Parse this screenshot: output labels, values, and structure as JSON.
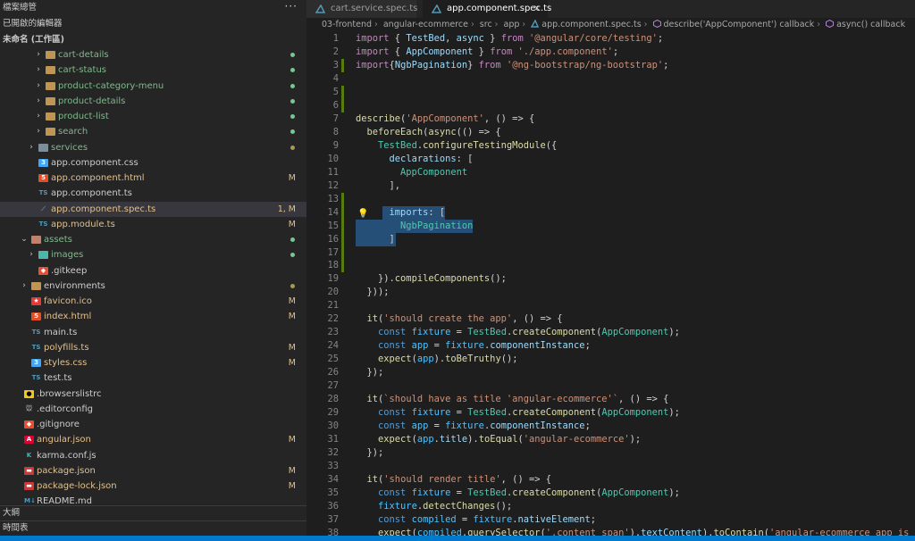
{
  "explorer": {
    "title": "檔案總管",
    "more": "···",
    "open_editors": "已開啟的編輯器",
    "workspace": "未命名 (工作區)",
    "outline": "大綱",
    "timeline": "時間表"
  },
  "colors": {
    "modified": "#e2c08d",
    "added_dot": "#73c991",
    "folder": "#c09553",
    "accent": "#007acc"
  },
  "tree": [
    {
      "label": "cart-details",
      "kind": "folder",
      "depth": 2,
      "expanded": false,
      "color": "#81b88b",
      "badge": "dot",
      "badge_color": "#73c991"
    },
    {
      "label": "cart-status",
      "kind": "folder",
      "depth": 2,
      "expanded": false,
      "color": "#81b88b",
      "badge": "dot",
      "badge_color": "#73c991"
    },
    {
      "label": "product-category-menu",
      "kind": "folder",
      "depth": 2,
      "expanded": false,
      "color": "#81b88b",
      "badge": "dot",
      "badge_color": "#73c991"
    },
    {
      "label": "product-details",
      "kind": "folder",
      "depth": 2,
      "expanded": false,
      "color": "#81b88b",
      "badge": "dot",
      "badge_color": "#73c991"
    },
    {
      "label": "product-list",
      "kind": "folder",
      "depth": 2,
      "expanded": false,
      "color": "#81b88b",
      "badge": "dot",
      "badge_color": "#73c991"
    },
    {
      "label": "search",
      "kind": "folder",
      "depth": 2,
      "expanded": false,
      "color": "#81b88b",
      "badge": "dot",
      "badge_color": "#73c991"
    },
    {
      "label": "services",
      "kind": "folder-services",
      "depth": 1,
      "expanded": false,
      "color": "#81b88b",
      "badge": "dot",
      "badge_color": "#a89a4f"
    },
    {
      "label": "app.component.css",
      "kind": "css",
      "depth": 1,
      "color": "#cccccc",
      "badge": "",
      "badge_color": ""
    },
    {
      "label": "app.component.html",
      "kind": "html",
      "depth": 1,
      "color": "#e2c08d",
      "badge": "M",
      "badge_color": "#e2c08d"
    },
    {
      "label": "app.component.ts",
      "kind": "ts",
      "depth": 1,
      "color": "#cccccc",
      "badge": "",
      "badge_color": ""
    },
    {
      "label": "app.component.spec.ts",
      "kind": "spec",
      "depth": 1,
      "color": "#e2c08d",
      "badge": "1, M",
      "badge_color": "#e2c08d",
      "selected": true
    },
    {
      "label": "app.module.ts",
      "kind": "ts",
      "depth": 1,
      "color": "#e2c08d",
      "badge": "M",
      "badge_color": "#e2c08d"
    },
    {
      "label": "assets",
      "kind": "folder-assets",
      "depth": 0,
      "expanded": true,
      "color": "#81b88b",
      "badge": "dot",
      "badge_color": "#73c991"
    },
    {
      "label": "images",
      "kind": "folder-images",
      "depth": 1,
      "expanded": false,
      "color": "#81b88b",
      "badge": "dot",
      "badge_color": "#73c991"
    },
    {
      "label": ".gitkeep",
      "kind": "git",
      "depth": 1,
      "color": "#cccccc",
      "badge": "",
      "badge_color": ""
    },
    {
      "label": "environments",
      "kind": "folder",
      "depth": 0,
      "expanded": false,
      "color": "#cccccc",
      "badge": "dot",
      "badge_color": "#a89a4f"
    },
    {
      "label": "favicon.ico",
      "kind": "ico",
      "depth": 0,
      "color": "#e2c08d",
      "badge": "M",
      "badge_color": "#e2c08d"
    },
    {
      "label": "index.html",
      "kind": "html",
      "depth": 0,
      "color": "#e2c08d",
      "badge": "M",
      "badge_color": "#e2c08d"
    },
    {
      "label": "main.ts",
      "kind": "ts",
      "depth": 0,
      "color": "#cccccc",
      "badge": "",
      "badge_color": ""
    },
    {
      "label": "polyfills.ts",
      "kind": "ts",
      "depth": 0,
      "color": "#e2c08d",
      "badge": "M",
      "badge_color": "#e2c08d"
    },
    {
      "label": "styles.css",
      "kind": "css",
      "depth": 0,
      "color": "#e2c08d",
      "badge": "M",
      "badge_color": "#e2c08d"
    },
    {
      "label": "test.ts",
      "kind": "ts",
      "depth": 0,
      "color": "#cccccc",
      "badge": "",
      "badge_color": ""
    },
    {
      "label": ".browserslistrc",
      "kind": "browsers",
      "depth": -1,
      "color": "#cccccc",
      "badge": "",
      "badge_color": ""
    },
    {
      "label": ".editorconfig",
      "kind": "editorconfig",
      "depth": -1,
      "color": "#cccccc",
      "badge": "",
      "badge_color": ""
    },
    {
      "label": ".gitignore",
      "kind": "git",
      "depth": -1,
      "color": "#cccccc",
      "badge": "",
      "badge_color": ""
    },
    {
      "label": "angular.json",
      "kind": "angular",
      "depth": -1,
      "color": "#e2c08d",
      "badge": "M",
      "badge_color": "#e2c08d"
    },
    {
      "label": "karma.conf.js",
      "kind": "karma",
      "depth": -1,
      "color": "#cccccc",
      "badge": "",
      "badge_color": ""
    },
    {
      "label": "package.json",
      "kind": "npm",
      "depth": -1,
      "color": "#e2c08d",
      "badge": "M",
      "badge_color": "#e2c08d"
    },
    {
      "label": "package-lock.json",
      "kind": "npm",
      "depth": -1,
      "color": "#e2c08d",
      "badge": "M",
      "badge_color": "#e2c08d"
    },
    {
      "label": "README.md",
      "kind": "md",
      "depth": -1,
      "color": "#cccccc",
      "badge": "",
      "badge_color": ""
    }
  ],
  "tabs": [
    {
      "label": "cart.service.spec.ts",
      "active": false
    },
    {
      "label": "app.component.spec.ts",
      "active": true,
      "close": "×"
    }
  ],
  "breadcrumb": [
    "03-frontend",
    "angular-ecommerce",
    "src",
    "app",
    "app.component.spec.ts",
    "describe('AppComponent') callback",
    "async() callback"
  ],
  "code": [
    {
      "n": "1",
      "g": "",
      "t": [
        [
          "kw",
          "import"
        ],
        [
          "pn",
          " { "
        ],
        [
          "id",
          "TestBed"
        ],
        [
          "pn",
          ", "
        ],
        [
          "id",
          "async"
        ],
        [
          "pn",
          " } "
        ],
        [
          "kw",
          "from"
        ],
        [
          "pn",
          " "
        ],
        [
          "str",
          "'@angular/core/testing'"
        ],
        [
          "pn",
          ";"
        ]
      ]
    },
    {
      "n": "2",
      "g": "",
      "t": [
        [
          "kw",
          "import"
        ],
        [
          "pn",
          " { "
        ],
        [
          "id",
          "AppComponent"
        ],
        [
          "pn",
          " } "
        ],
        [
          "kw",
          "from"
        ],
        [
          "pn",
          " "
        ],
        [
          "str",
          "'./app.component'"
        ],
        [
          "pn",
          ";"
        ]
      ]
    },
    {
      "n": "3",
      "g": "#587c0c",
      "t": [
        [
          "kw",
          "import"
        ],
        [
          "pn",
          "{"
        ],
        [
          "id",
          "NgbPagination"
        ],
        [
          "pn",
          "} "
        ],
        [
          "kw",
          "from"
        ],
        [
          "pn",
          " "
        ],
        [
          "str",
          "'@ng-bootstrap/ng-bootstrap'"
        ],
        [
          "pn",
          ";"
        ]
      ]
    },
    {
      "n": "4",
      "g": "",
      "t": []
    },
    {
      "n": "5",
      "g": "#587c0c",
      "t": []
    },
    {
      "n": "6",
      "g": "#587c0c",
      "t": []
    },
    {
      "n": "7",
      "g": "",
      "t": [
        [
          "fn",
          "describe"
        ],
        [
          "pn",
          "("
        ],
        [
          "str",
          "'AppComponent'"
        ],
        [
          "pn",
          ", () => {"
        ]
      ]
    },
    {
      "n": "8",
      "g": "",
      "t": [
        [
          "pn",
          "  "
        ],
        [
          "fn",
          "beforeEach"
        ],
        [
          "pn",
          "("
        ],
        [
          "fn",
          "async"
        ],
        [
          "pn",
          "(() => {"
        ]
      ]
    },
    {
      "n": "9",
      "g": "",
      "t": [
        [
          "pn",
          "    "
        ],
        [
          "cls",
          "TestBed"
        ],
        [
          "pn",
          "."
        ],
        [
          "fn",
          "configureTestingModule"
        ],
        [
          "pn",
          "({"
        ]
      ]
    },
    {
      "n": "10",
      "g": "",
      "t": [
        [
          "pn",
          "      "
        ],
        [
          "id",
          "declarations"
        ],
        [
          "pn",
          ": ["
        ]
      ]
    },
    {
      "n": "11",
      "g": "",
      "t": [
        [
          "pn",
          "        "
        ],
        [
          "cls",
          "AppComponent"
        ]
      ]
    },
    {
      "n": "12",
      "g": "",
      "t": [
        [
          "pn",
          "      ],"
        ]
      ]
    },
    {
      "n": "13",
      "g": "#587c0c",
      "t": []
    },
    {
      "n": "14",
      "g": "#587c0c",
      "t": [
        [
          "pn",
          "      "
        ],
        [
          "id",
          "imports"
        ],
        [
          "pn",
          ": ["
        ]
      ],
      "bulb": "💡"
    },
    {
      "n": "15",
      "g": "#587c0c",
      "t": [
        [
          "pn",
          "        "
        ],
        [
          "cls",
          "NgbPagination"
        ]
      ]
    },
    {
      "n": "16",
      "g": "#587c0c",
      "t": [
        [
          "pn",
          "      ]"
        ]
      ]
    },
    {
      "n": "17",
      "g": "#587c0c",
      "t": []
    },
    {
      "n": "18",
      "g": "#587c0c",
      "t": []
    },
    {
      "n": "19",
      "g": "",
      "t": [
        [
          "pn",
          "    })."
        ],
        [
          "fn",
          "compileComponents"
        ],
        [
          "pn",
          "();"
        ]
      ]
    },
    {
      "n": "20",
      "g": "",
      "t": [
        [
          "pn",
          "  }));"
        ]
      ]
    },
    {
      "n": "21",
      "g": "",
      "t": []
    },
    {
      "n": "22",
      "g": "",
      "t": [
        [
          "pn",
          "  "
        ],
        [
          "fn",
          "it"
        ],
        [
          "pn",
          "("
        ],
        [
          "str",
          "'should create the app'"
        ],
        [
          "pn",
          ", () => {"
        ]
      ]
    },
    {
      "n": "23",
      "g": "",
      "t": [
        [
          "pn",
          "    "
        ],
        [
          "kw2",
          "const"
        ],
        [
          "pn",
          " "
        ],
        [
          "nw",
          "fixture"
        ],
        [
          "pn",
          " = "
        ],
        [
          "cls",
          "TestBed"
        ],
        [
          "pn",
          "."
        ],
        [
          "fn",
          "createComponent"
        ],
        [
          "pn",
          "("
        ],
        [
          "cls",
          "AppComponent"
        ],
        [
          "pn",
          ");"
        ]
      ]
    },
    {
      "n": "24",
      "g": "",
      "t": [
        [
          "pn",
          "    "
        ],
        [
          "kw2",
          "const"
        ],
        [
          "pn",
          " "
        ],
        [
          "nw",
          "app"
        ],
        [
          "pn",
          " = "
        ],
        [
          "nw",
          "fixture"
        ],
        [
          "pn",
          "."
        ],
        [
          "id",
          "componentInstance"
        ],
        [
          "pn",
          ";"
        ]
      ]
    },
    {
      "n": "25",
      "g": "",
      "t": [
        [
          "pn",
          "    "
        ],
        [
          "fn",
          "expect"
        ],
        [
          "pn",
          "("
        ],
        [
          "nw",
          "app"
        ],
        [
          "pn",
          ")."
        ],
        [
          "fn",
          "toBeTruthy"
        ],
        [
          "pn",
          "();"
        ]
      ]
    },
    {
      "n": "26",
      "g": "",
      "t": [
        [
          "pn",
          "  });"
        ]
      ]
    },
    {
      "n": "27",
      "g": "",
      "t": []
    },
    {
      "n": "28",
      "g": "",
      "t": [
        [
          "pn",
          "  "
        ],
        [
          "fn",
          "it"
        ],
        [
          "pn",
          "("
        ],
        [
          "str",
          "`should have as title 'angular-ecommerce'`"
        ],
        [
          "pn",
          ", () => {"
        ]
      ]
    },
    {
      "n": "29",
      "g": "",
      "t": [
        [
          "pn",
          "    "
        ],
        [
          "kw2",
          "const"
        ],
        [
          "pn",
          " "
        ],
        [
          "nw",
          "fixture"
        ],
        [
          "pn",
          " = "
        ],
        [
          "cls",
          "TestBed"
        ],
        [
          "pn",
          "."
        ],
        [
          "fn",
          "createComponent"
        ],
        [
          "pn",
          "("
        ],
        [
          "cls",
          "AppComponent"
        ],
        [
          "pn",
          ");"
        ]
      ]
    },
    {
      "n": "30",
      "g": "",
      "t": [
        [
          "pn",
          "    "
        ],
        [
          "kw2",
          "const"
        ],
        [
          "pn",
          " "
        ],
        [
          "nw",
          "app"
        ],
        [
          "pn",
          " = "
        ],
        [
          "nw",
          "fixture"
        ],
        [
          "pn",
          "."
        ],
        [
          "id",
          "componentInstance"
        ],
        [
          "pn",
          ";"
        ]
      ]
    },
    {
      "n": "31",
      "g": "",
      "t": [
        [
          "pn",
          "    "
        ],
        [
          "fn",
          "expect"
        ],
        [
          "pn",
          "("
        ],
        [
          "nw",
          "app"
        ],
        [
          "pn",
          "."
        ],
        [
          "id",
          "title"
        ],
        [
          "pn",
          ")."
        ],
        [
          "fn",
          "toEqual"
        ],
        [
          "pn",
          "("
        ],
        [
          "str",
          "'angular-ecommerce'"
        ],
        [
          "pn",
          ");"
        ]
      ]
    },
    {
      "n": "32",
      "g": "",
      "t": [
        [
          "pn",
          "  });"
        ]
      ]
    },
    {
      "n": "33",
      "g": "",
      "t": []
    },
    {
      "n": "34",
      "g": "",
      "t": [
        [
          "pn",
          "  "
        ],
        [
          "fn",
          "it"
        ],
        [
          "pn",
          "("
        ],
        [
          "str",
          "'should render title'"
        ],
        [
          "pn",
          ", () => {"
        ]
      ]
    },
    {
      "n": "35",
      "g": "",
      "t": [
        [
          "pn",
          "    "
        ],
        [
          "kw2",
          "const"
        ],
        [
          "pn",
          " "
        ],
        [
          "nw",
          "fixture"
        ],
        [
          "pn",
          " = "
        ],
        [
          "cls",
          "TestBed"
        ],
        [
          "pn",
          "."
        ],
        [
          "fn",
          "createComponent"
        ],
        [
          "pn",
          "("
        ],
        [
          "cls",
          "AppComponent"
        ],
        [
          "pn",
          ");"
        ]
      ]
    },
    {
      "n": "36",
      "g": "",
      "t": [
        [
          "pn",
          "    "
        ],
        [
          "nw",
          "fixture"
        ],
        [
          "pn",
          "."
        ],
        [
          "fn",
          "detectChanges"
        ],
        [
          "pn",
          "();"
        ]
      ]
    },
    {
      "n": "37",
      "g": "",
      "t": [
        [
          "pn",
          "    "
        ],
        [
          "kw2",
          "const"
        ],
        [
          "pn",
          " "
        ],
        [
          "nw",
          "compiled"
        ],
        [
          "pn",
          " = "
        ],
        [
          "nw",
          "fixture"
        ],
        [
          "pn",
          "."
        ],
        [
          "id",
          "nativeElement"
        ],
        [
          "pn",
          ";"
        ]
      ]
    },
    {
      "n": "38",
      "g": "",
      "t": [
        [
          "pn",
          "    "
        ],
        [
          "fn",
          "expect"
        ],
        [
          "pn",
          "("
        ],
        [
          "nw",
          "compiled"
        ],
        [
          "pn",
          "."
        ],
        [
          "fn",
          "querySelector"
        ],
        [
          "pn",
          "("
        ],
        [
          "str",
          "'.content span'"
        ],
        [
          "pn",
          ")."
        ],
        [
          "id",
          "textContent"
        ],
        [
          "pn",
          ")."
        ],
        [
          "fn",
          "toContain"
        ],
        [
          "pn",
          "("
        ],
        [
          "str",
          "'angular-ecommerce app is running!'"
        ],
        [
          "pn",
          ");"
        ]
      ]
    }
  ]
}
